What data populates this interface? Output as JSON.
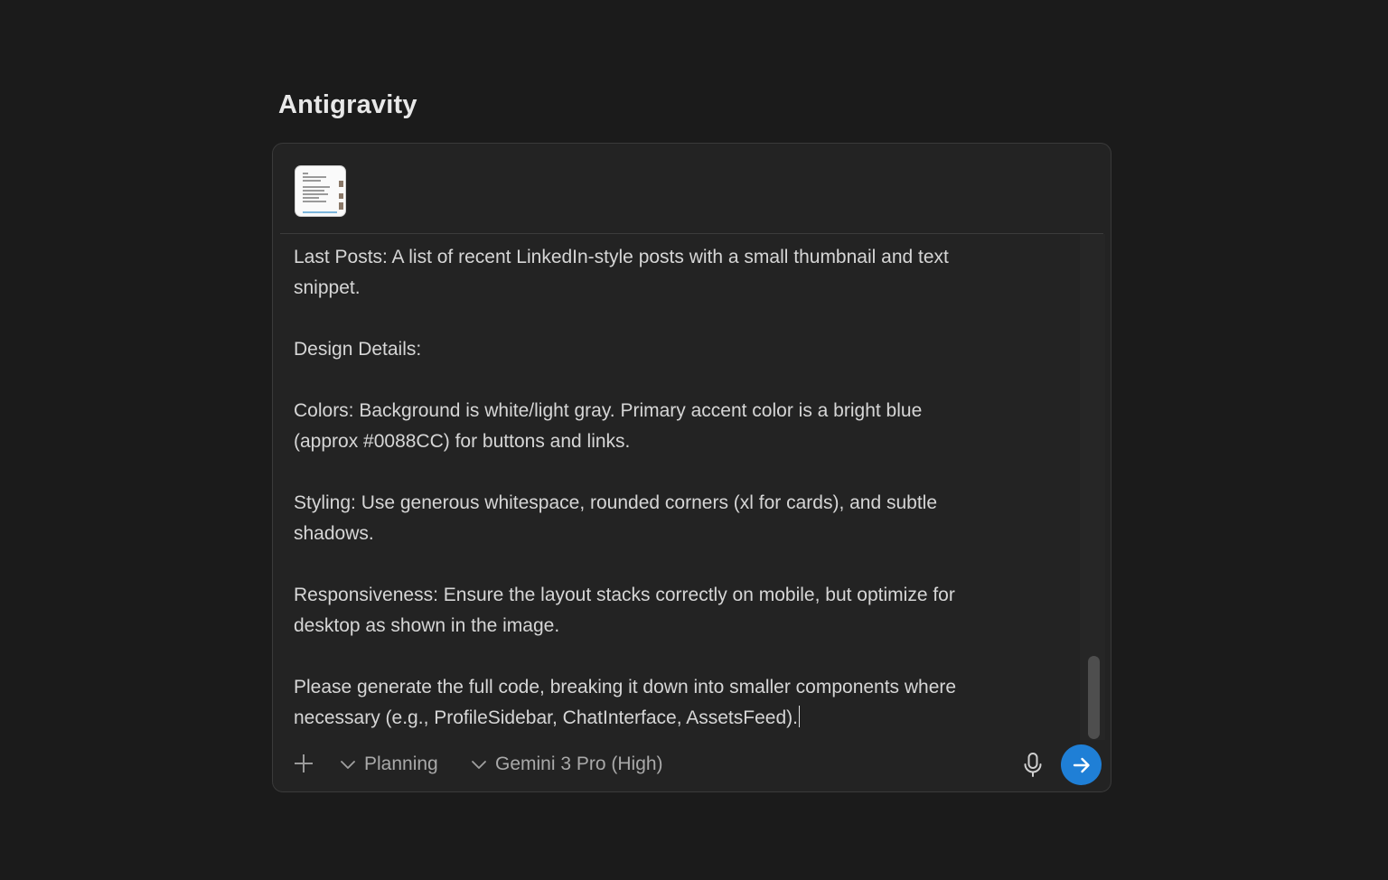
{
  "app": {
    "title": "Antigravity"
  },
  "composer": {
    "attachments": [
      {
        "type": "image",
        "icon": "image-thumbnail"
      }
    ],
    "prompt_text": "Last Posts: A list of recent LinkedIn-style posts with a small thumbnail and text\nsnippet.\n\nDesign Details:\n\nColors: Background is white/light gray. Primary accent color is a bright blue\n(approx #0088CC) for buttons and links.\n\nStyling: Use generous whitespace, rounded corners (xl for cards), and subtle\nshadows.\n\nResponsiveness: Ensure the layout stacks correctly on mobile, but optimize for\ndesktop as shown in the image.\n\nPlease generate the full code, breaking it down into smaller components where\nnecessary (e.g., ProfileSidebar, ChatInterface, AssetsFeed).",
    "toolbar": {
      "add_icon": "plus-icon",
      "mode_label": "Planning",
      "model_label": "Gemini 3 Pro (High)",
      "mic_icon": "microphone-icon",
      "send_icon": "arrow-right-icon"
    }
  },
  "colors": {
    "background": "#1b1b1b",
    "panel": "#232323",
    "accent": "#1f7fd6"
  }
}
